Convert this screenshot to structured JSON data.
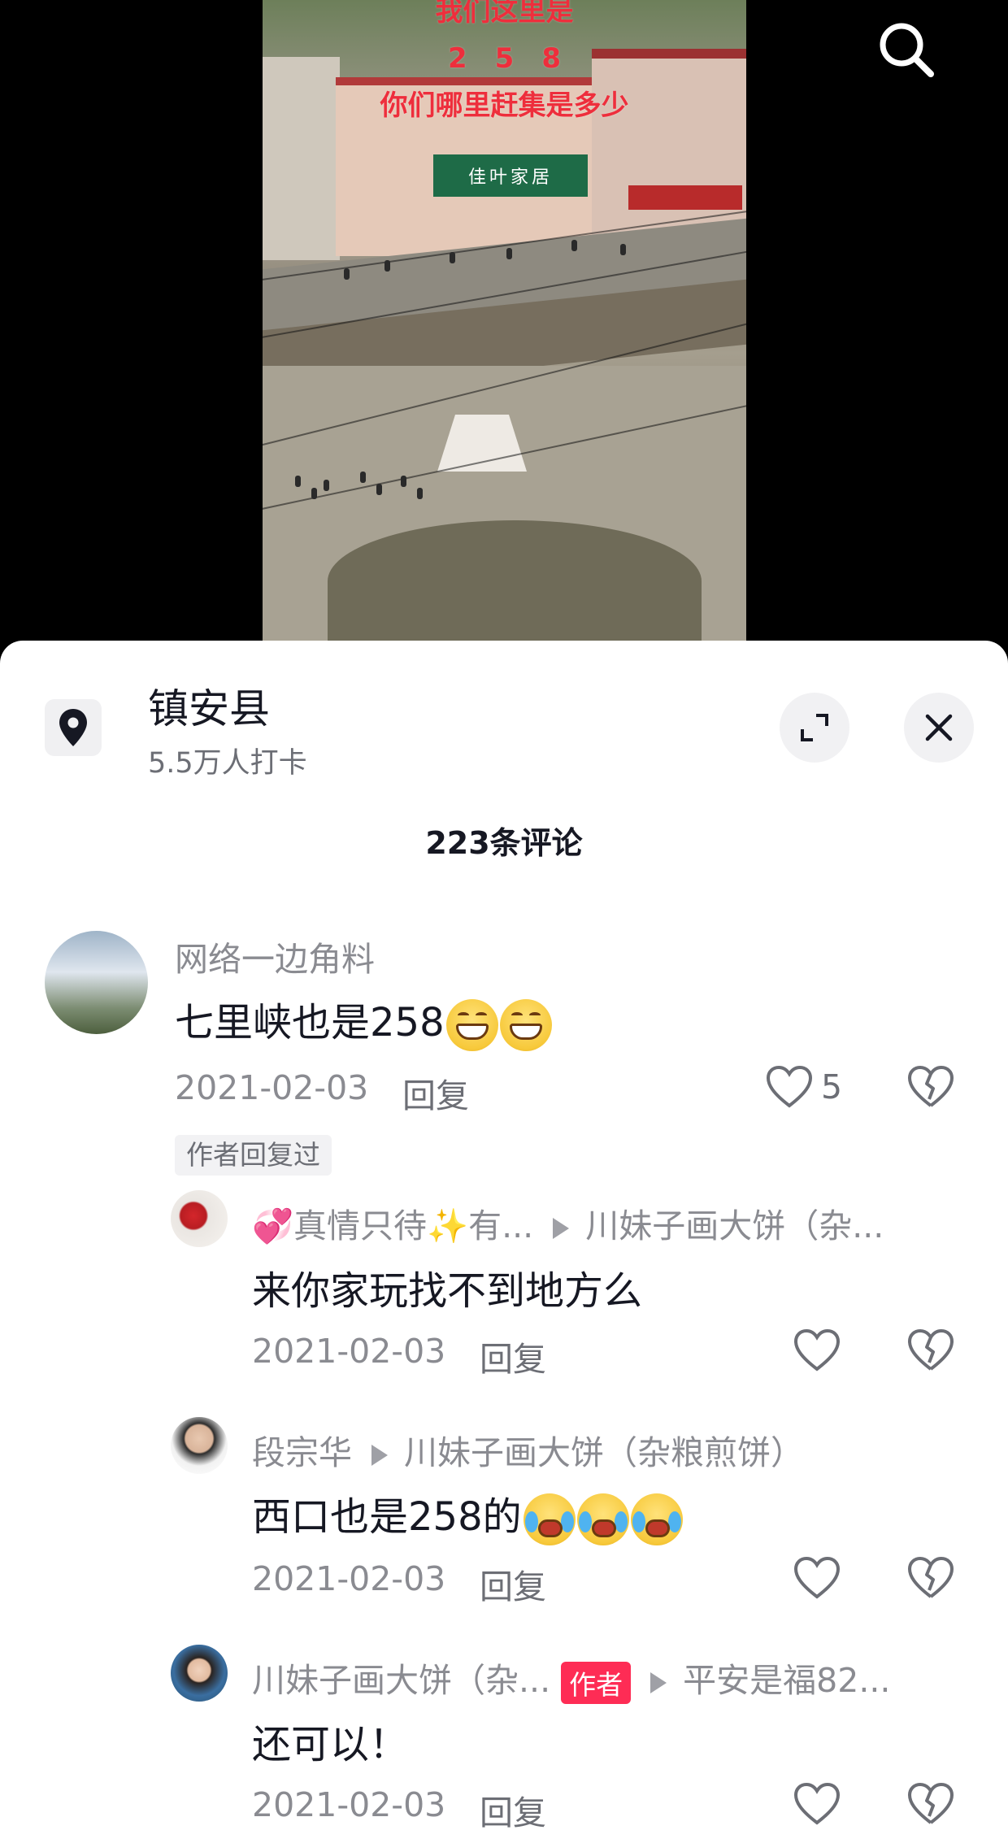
{
  "video": {
    "caption_line1": "我们这里是",
    "caption_line2": "2　5　8",
    "caption_line3": "你们哪里赶集是多少",
    "shop_sign": "佳叶家居",
    "search_icon": "search-icon"
  },
  "location": {
    "name": "镇安县",
    "checkins": "5.5万人打卡",
    "icon": "map-pin-icon"
  },
  "header": {
    "comment_count": "223条评论",
    "expand_icon": "expand-icon",
    "close_icon": "close-icon"
  },
  "comments": [
    {
      "username": "网络一边角料",
      "text": "七里峡也是258",
      "emojis": [
        "grin",
        "grin"
      ],
      "date": "2021-02-03",
      "reply_label": "回复",
      "likes": "5",
      "author_replied": "作者回复过"
    }
  ],
  "replies": [
    {
      "username": "💞真情只待✨有...",
      "reply_to": "川妹子画大饼（杂...",
      "text": "来你家玩找不到地方么",
      "date": "2021-02-03",
      "reply_label": "回复"
    },
    {
      "username": "段宗华",
      "reply_to": "川妹子画大饼（杂粮煎饼）",
      "text": "西口也是258的",
      "emojis": [
        "cry",
        "cry",
        "cry"
      ],
      "date": "2021-02-03",
      "reply_label": "回复"
    },
    {
      "username": "川妹子画大饼（杂...",
      "badge": "作者",
      "reply_to": "平安是福82...",
      "text": "还可以！",
      "date": "2021-02-03",
      "reply_label": "回复"
    }
  ],
  "colors": {
    "accent": "#fe2c55",
    "caption_red": "#ee2e3c",
    "muted_text": "#8a8b91"
  }
}
